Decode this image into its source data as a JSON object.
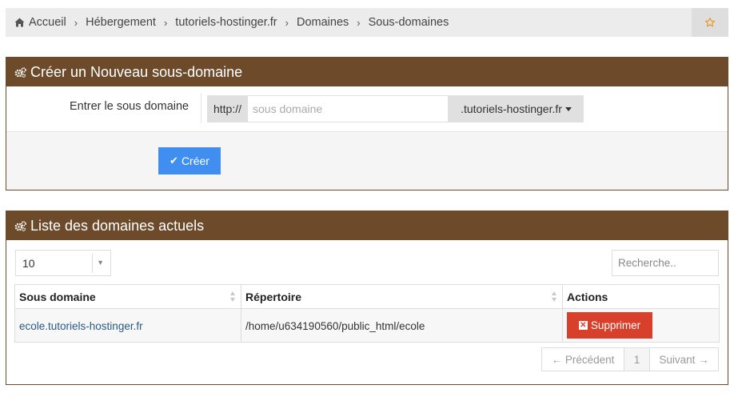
{
  "breadcrumb": {
    "items": [
      "Accueil",
      "Hébergement",
      "tutoriels-hostinger.fr",
      "Domaines",
      "Sous-domaines"
    ],
    "home_icon": "home-icon",
    "favorite_icon": "star-icon",
    "favorite_color": "#e69a27"
  },
  "create_panel": {
    "title": "Créer un Nouveau sous-domaine",
    "field_label": "Entrer le sous domaine",
    "prefix": "http://",
    "input_placeholder": "sous domaine",
    "input_value": "",
    "domain_selected": ".tutoriels-hostinger.fr",
    "submit_label": "Créer",
    "submit_color": "#3f8ef0"
  },
  "list_panel": {
    "title": "Liste des domaines actuels",
    "page_length": "10",
    "search_placeholder": "Recherche..",
    "columns": [
      "Sous domaine",
      "Répertoire",
      "Actions"
    ],
    "rows": [
      {
        "subdomain": "ecole.tutoriels-hostinger.fr",
        "directory": "/home/u634190560/public_html/ecole",
        "action_label": "Supprimer"
      }
    ],
    "pagination": {
      "prev": "← Précédent",
      "current": "1",
      "next": "Suivant →"
    }
  },
  "colors": {
    "panel_header": "#6c4a2a",
    "delete_button": "#d9402c",
    "link": "#2a5a85"
  }
}
